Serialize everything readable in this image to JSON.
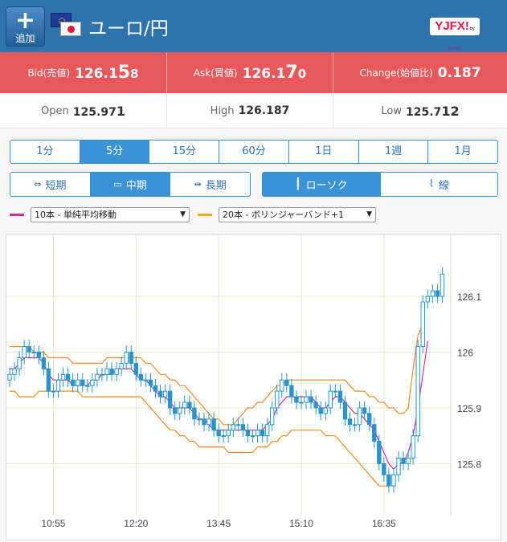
{
  "header": {
    "add_label": "追加",
    "add_symbol": "+",
    "pair": "ユーロ/円",
    "brand_main": "YJFX!",
    "brand_sub": "by Yahoo!"
  },
  "quotes": {
    "bid": {
      "label": "Bid(売値)",
      "value_main": "126.1",
      "value_pip": "5",
      "value_last": "8"
    },
    "ask": {
      "label": "Ask(買値)",
      "value_main": "126.1",
      "value_pip": "7",
      "value_last": "0"
    },
    "change": {
      "label": "Change(始値比)",
      "value": "0.187"
    }
  },
  "stats": {
    "open": {
      "label": "Open",
      "value_main": "125.97",
      "value_last": "1"
    },
    "high": {
      "label": "High",
      "value": "126.187"
    },
    "low": {
      "label": "Low",
      "value_main": "125.7",
      "value_last": "12"
    }
  },
  "timeframes": [
    "1分",
    "5分",
    "15分",
    "60分",
    "1日",
    "1週",
    "1月"
  ],
  "active_timeframe": "5分",
  "terms": [
    {
      "label": "短期",
      "icon": "short-term-icon"
    },
    {
      "label": "中期",
      "icon": "mid-term-icon"
    },
    {
      "label": "長期",
      "icon": "long-term-icon"
    }
  ],
  "active_term": "中期",
  "chart_types": [
    {
      "label": "ローソク",
      "icon": "candlestick-icon"
    },
    {
      "label": "線",
      "icon": "line-chart-icon"
    }
  ],
  "active_chart_type": "ローソク",
  "indicators": [
    {
      "label": "10本 - 単純平均移動",
      "color": "#cc3399"
    },
    {
      "label": "20本 - ボリンジャーバンド+1",
      "color": "#f5a623"
    }
  ],
  "colors": {
    "header": "#2f73ad",
    "quote_band": "#e8575a",
    "accent": "#3a93d4",
    "candle": "#2a93c9",
    "sma": "#cc3399",
    "bollinger": "#f08a24"
  },
  "chart_data": {
    "type": "candlestick",
    "title": "",
    "xlabel": "",
    "ylabel": "",
    "ylim": [
      125.707,
      126.211
    ],
    "yticks": [
      "126.1",
      "126",
      "125.9",
      "125.8"
    ],
    "xticks": [
      "10:55",
      "12:20",
      "13:45",
      "15:10",
      "16:35"
    ],
    "grid": true,
    "close": [
      125.96,
      125.97,
      125.99,
      126.01,
      126.0,
      126.0,
      125.99,
      125.97,
      125.93,
      125.93,
      125.95,
      125.96,
      125.95,
      125.94,
      125.95,
      125.94,
      125.94,
      125.95,
      125.96,
      125.96,
      125.97,
      125.96,
      125.97,
      125.98,
      126.0,
      125.98,
      125.96,
      125.95,
      125.95,
      125.94,
      125.93,
      125.92,
      125.93,
      125.9,
      125.89,
      125.9,
      125.91,
      125.9,
      125.88,
      125.88,
      125.87,
      125.88,
      125.86,
      125.85,
      125.85,
      125.86,
      125.87,
      125.87,
      125.86,
      125.85,
      125.85,
      125.86,
      125.85,
      125.87,
      125.9,
      125.93,
      125.95,
      125.94,
      125.92,
      125.91,
      125.91,
      125.92,
      125.91,
      125.9,
      125.89,
      125.9,
      125.93,
      125.93,
      125.91,
      125.88,
      125.87,
      125.87,
      125.9,
      125.89,
      125.87,
      125.84,
      125.8,
      125.78,
      125.76,
      125.78,
      125.81,
      125.8,
      125.81,
      125.85,
      126.01,
      126.09,
      126.1,
      126.11,
      126.1,
      126.14
    ],
    "sma10": [
      125.97,
      125.97,
      125.98,
      125.99,
      125.99,
      125.99,
      125.99,
      125.98,
      125.96,
      125.95,
      125.95,
      125.95,
      125.95,
      125.94,
      125.94,
      125.94,
      125.94,
      125.95,
      125.95,
      125.96,
      125.96,
      125.96,
      125.97,
      125.97,
      125.97,
      125.97,
      125.96,
      125.95,
      125.95,
      125.94,
      125.93,
      125.92,
      125.92,
      125.91,
      125.9,
      125.9,
      125.9,
      125.9,
      125.89,
      125.88,
      125.88,
      125.87,
      125.86,
      125.86,
      125.86,
      125.86,
      125.86,
      125.86,
      125.86,
      125.86,
      125.86,
      125.86,
      125.86,
      125.87,
      125.88,
      125.9,
      125.91,
      125.92,
      125.92,
      125.92,
      125.92,
      125.92,
      125.92,
      125.91,
      125.9,
      125.9,
      125.91,
      125.92,
      125.92,
      125.91,
      125.9,
      125.89,
      125.89,
      125.88,
      125.87,
      125.86,
      125.84,
      125.82,
      125.8,
      125.79,
      125.8,
      125.8,
      125.82,
      125.85,
      125.9,
      125.96,
      126.02
    ],
    "bb_upper": [
      126.01,
      126.01,
      126.01,
      126.01,
      126.01,
      126.0,
      126.0,
      126.0,
      125.99,
      125.99,
      125.99,
      125.99,
      125.99,
      125.98,
      125.98,
      125.98,
      125.98,
      125.98,
      125.98,
      125.98,
      125.99,
      125.99,
      125.99,
      125.99,
      125.99,
      125.99,
      125.99,
      125.99,
      125.98,
      125.98,
      125.97,
      125.96,
      125.96,
      125.95,
      125.95,
      125.94,
      125.94,
      125.93,
      125.92,
      125.91,
      125.9,
      125.89,
      125.88,
      125.88,
      125.87,
      125.87,
      125.87,
      125.88,
      125.89,
      125.9,
      125.9,
      125.91,
      125.91,
      125.92,
      125.93,
      125.94,
      125.94,
      125.95,
      125.95,
      125.95,
      125.95,
      125.95,
      125.95,
      125.95,
      125.95,
      125.95,
      125.95,
      125.95,
      125.95,
      125.95,
      125.94,
      125.93,
      125.93,
      125.93,
      125.92,
      125.92,
      125.91,
      125.91,
      125.9,
      125.9,
      125.89,
      125.89,
      125.9,
      125.97,
      126.03,
      126.05
    ],
    "bb_lower": [
      125.93,
      125.93,
      125.92,
      125.92,
      125.92,
      125.92,
      125.93,
      125.93,
      125.93,
      125.93,
      125.93,
      125.93,
      125.93,
      125.93,
      125.93,
      125.92,
      125.92,
      125.92,
      125.92,
      125.92,
      125.92,
      125.92,
      125.92,
      125.92,
      125.92,
      125.92,
      125.92,
      125.92,
      125.91,
      125.9,
      125.89,
      125.88,
      125.87,
      125.86,
      125.86,
      125.85,
      125.85,
      125.84,
      125.84,
      125.83,
      125.83,
      125.83,
      125.83,
      125.83,
      125.83,
      125.82,
      125.82,
      125.82,
      125.82,
      125.82,
      125.82,
      125.83,
      125.83,
      125.83,
      125.84,
      125.84,
      125.85,
      125.85,
      125.86,
      125.86,
      125.86,
      125.86,
      125.86,
      125.86,
      125.86,
      125.85,
      125.85,
      125.85,
      125.84,
      125.83,
      125.82,
      125.81,
      125.8,
      125.79,
      125.78,
      125.77,
      125.76,
      125.76,
      125.76
    ]
  }
}
